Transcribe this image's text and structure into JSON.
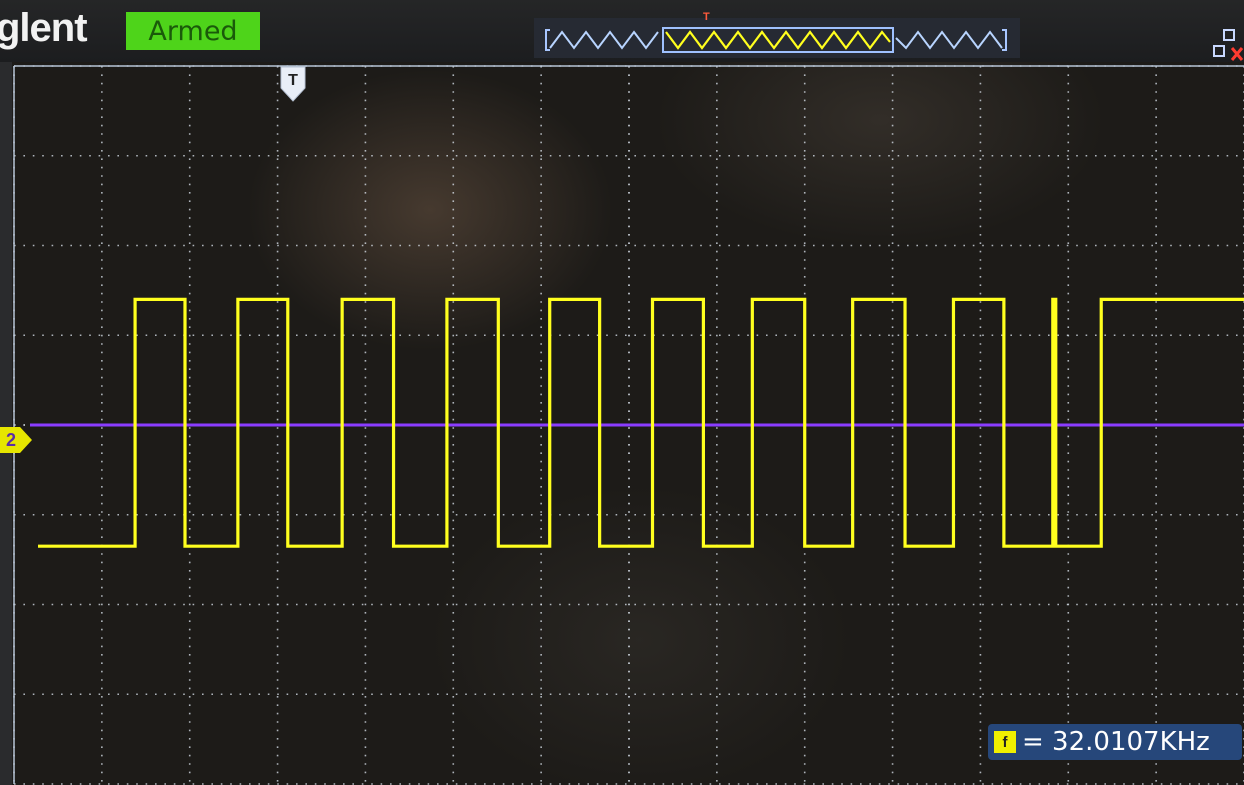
{
  "header": {
    "brand_fragment": "glent",
    "status": "Armed"
  },
  "measurement": {
    "icon_label": "f",
    "text": "= 32.0107KHz"
  },
  "markers": {
    "trigger_label": "T",
    "trigger_top_label": "T",
    "channel_label": "2"
  },
  "colors": {
    "channel1": "#ffff1e",
    "channel2": "#8a3cff",
    "status_badge": "#4ed41a",
    "grid_dots": "#dfe8f2",
    "frequency_box": "#26477a"
  },
  "chart_data": {
    "type": "line",
    "title": "",
    "xlabel": "",
    "ylabel": "",
    "grid": true,
    "grid_divisions": {
      "x": 14,
      "y": 8
    },
    "xlim": [
      0,
      14
    ],
    "ylim": [
      -4,
      4
    ],
    "series": [
      {
        "channel": "CH1",
        "color": "#ffff1e",
        "waveform": "square",
        "rising_edges": [
          0.34,
          2.45,
          4.53,
          6.64,
          8.76,
          10.84,
          12.92,
          14.94,
          16.97,
          19.01,
          21.02,
          22.0
        ],
        "falling_edges": [
          1.38,
          3.46,
          5.54,
          7.68,
          9.8,
          11.85,
          13.95,
          16.0,
          18.03,
          20.03,
          21.08
        ],
        "high_level": 1.4,
        "low_level": -1.35,
        "time_scale_factor": 0.5625
      },
      {
        "channel": "CH2",
        "color": "#8a3cff",
        "waveform": "flat",
        "level": 0
      }
    ]
  }
}
